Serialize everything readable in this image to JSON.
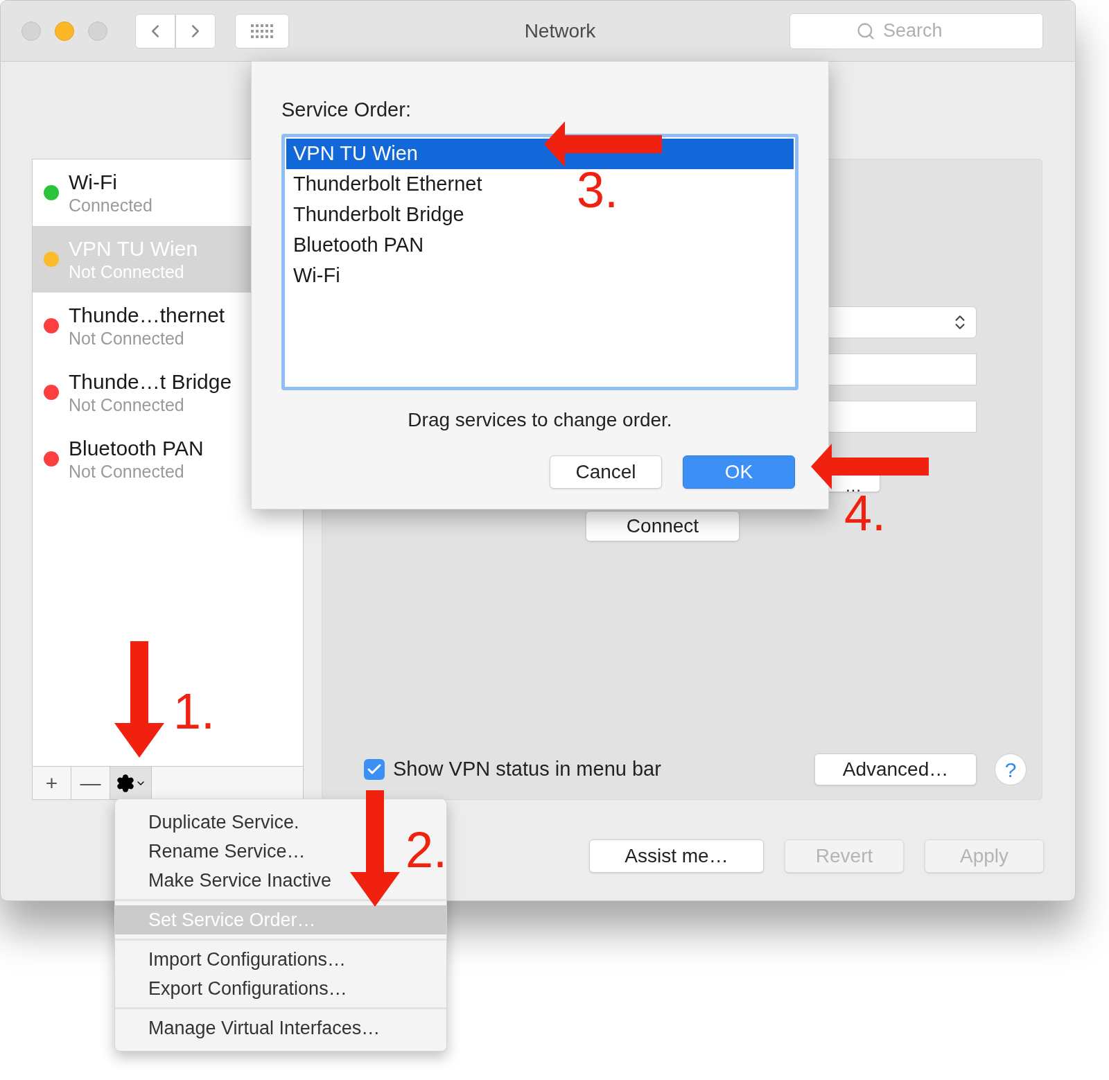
{
  "window": {
    "title": "Network"
  },
  "search": {
    "placeholder": "Search"
  },
  "services": [
    {
      "name": "Wi-Fi",
      "status": "Connected",
      "color": "#2ac43a",
      "selected": false
    },
    {
      "name": "VPN TU Wien",
      "status": "Not Connected",
      "color": "#fcbb2a",
      "selected": true
    },
    {
      "name": "Thunde…thernet",
      "status": "Not Connected",
      "color": "#fc4040",
      "selected": false
    },
    {
      "name": "Thunde…t Bridge",
      "status": "Not Connected",
      "color": "#fc4040",
      "selected": false
    },
    {
      "name": "Bluetooth PAN",
      "status": "Not Connected",
      "color": "#fc4040",
      "selected": false
    }
  ],
  "sidebar_buttons": [
    "+",
    "—"
  ],
  "panel": {
    "partial_button": "…",
    "connect": "Connect",
    "show_status": {
      "label": "Show VPN status in menu bar",
      "checked": true
    },
    "advanced": "Advanced…",
    "help": "?"
  },
  "footer_buttons": [
    {
      "label": "Assist me…",
      "disabled": false
    },
    {
      "label": "Revert",
      "disabled": true
    },
    {
      "label": "Apply",
      "disabled": true
    }
  ],
  "dialog": {
    "title": "Service Order:",
    "services": [
      {
        "name": "VPN TU Wien",
        "selected": true
      },
      {
        "name": "Thunderbolt Ethernet",
        "selected": false
      },
      {
        "name": "Thunderbolt Bridge",
        "selected": false
      },
      {
        "name": "Bluetooth PAN",
        "selected": false
      },
      {
        "name": "Wi-Fi",
        "selected": false
      }
    ],
    "hint": "Drag services to change order.",
    "buttons": [
      {
        "label": "Cancel",
        "default": false
      },
      {
        "label": "OK",
        "default": true
      }
    ]
  },
  "menu": {
    "groups": [
      [
        {
          "label": "Duplicate Service.",
          "selected": false
        },
        {
          "label": "Rename Service…",
          "selected": false
        },
        {
          "label": "Make Service Inactive",
          "selected": false
        }
      ],
      [
        {
          "label": "Set Service Order…",
          "selected": true
        }
      ],
      [
        {
          "label": "Import Configurations…",
          "selected": false
        },
        {
          "label": "Export Configurations…",
          "selected": false
        }
      ],
      [
        {
          "label": "Manage Virtual Interfaces…",
          "selected": false
        }
      ]
    ]
  },
  "annotations": [
    {
      "label": "1.",
      "kind": "down"
    },
    {
      "label": "2.",
      "kind": "down"
    },
    {
      "label": "3.",
      "kind": "left"
    },
    {
      "label": "4.",
      "kind": "left"
    }
  ]
}
